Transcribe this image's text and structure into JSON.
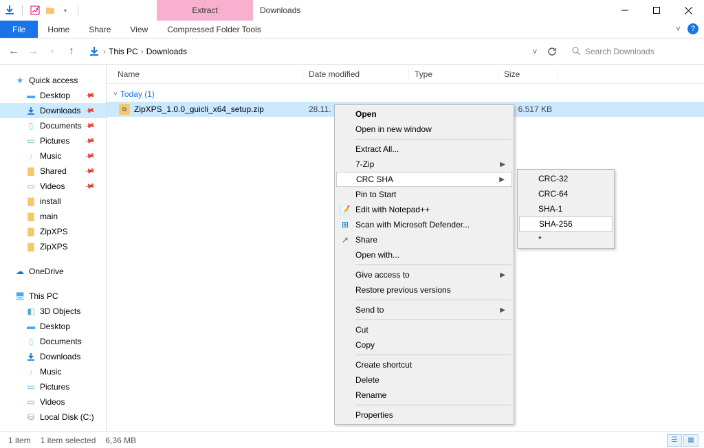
{
  "window": {
    "title": "Downloads",
    "contextual_tab": "Extract",
    "contextual_group": "Compressed Folder Tools"
  },
  "ribbon": {
    "file": "File",
    "home": "Home",
    "share": "Share",
    "view": "View",
    "help": "?"
  },
  "nav": {
    "crumb_root": "This PC",
    "crumb_current": "Downloads",
    "search_placeholder": "Search Downloads"
  },
  "sidebar": {
    "quick_access": "Quick access",
    "desktop": "Desktop",
    "downloads": "Downloads",
    "documents": "Documents",
    "pictures": "Pictures",
    "music": "Music",
    "shared": "Shared",
    "videos": "Videos",
    "install": "install",
    "main": "main",
    "zipxps1": "ZipXPS",
    "zipxps2": "ZipXPS",
    "onedrive": "OneDrive",
    "this_pc": "This PC",
    "objects3d": "3D Objects",
    "desktop2": "Desktop",
    "documents2": "Documents",
    "downloads2": "Downloads",
    "music2": "Music",
    "pictures2": "Pictures",
    "videos2": "Videos",
    "localdisk": "Local Disk (C:)"
  },
  "columns": {
    "name": "Name",
    "date": "Date modified",
    "type": "Type",
    "size": "Size"
  },
  "group": {
    "today": "Today (1)"
  },
  "file": {
    "name": "ZipXPS_1.0.0_guicli_x64_setup.zip",
    "date": "28.11.",
    "size": "6.517 KB"
  },
  "context_menu": {
    "open": "Open",
    "open_new": "Open in new window",
    "extract_all": "Extract All...",
    "sevenzip": "7-Zip",
    "crc_sha": "CRC SHA",
    "pin_start": "Pin to Start",
    "edit_npp": "Edit with Notepad++",
    "scan_defender": "Scan with Microsoft Defender...",
    "share": "Share",
    "open_with": "Open with...",
    "give_access": "Give access to",
    "restore_prev": "Restore previous versions",
    "send_to": "Send to",
    "cut": "Cut",
    "copy": "Copy",
    "create_shortcut": "Create shortcut",
    "delete": "Delete",
    "rename": "Rename",
    "properties": "Properties"
  },
  "submenu": {
    "crc32": "CRC-32",
    "crc64": "CRC-64",
    "sha1": "SHA-1",
    "sha256": "SHA-256",
    "star": "*"
  },
  "status": {
    "items": "1 item",
    "selected": "1 item selected",
    "size": "6,36 MB"
  }
}
